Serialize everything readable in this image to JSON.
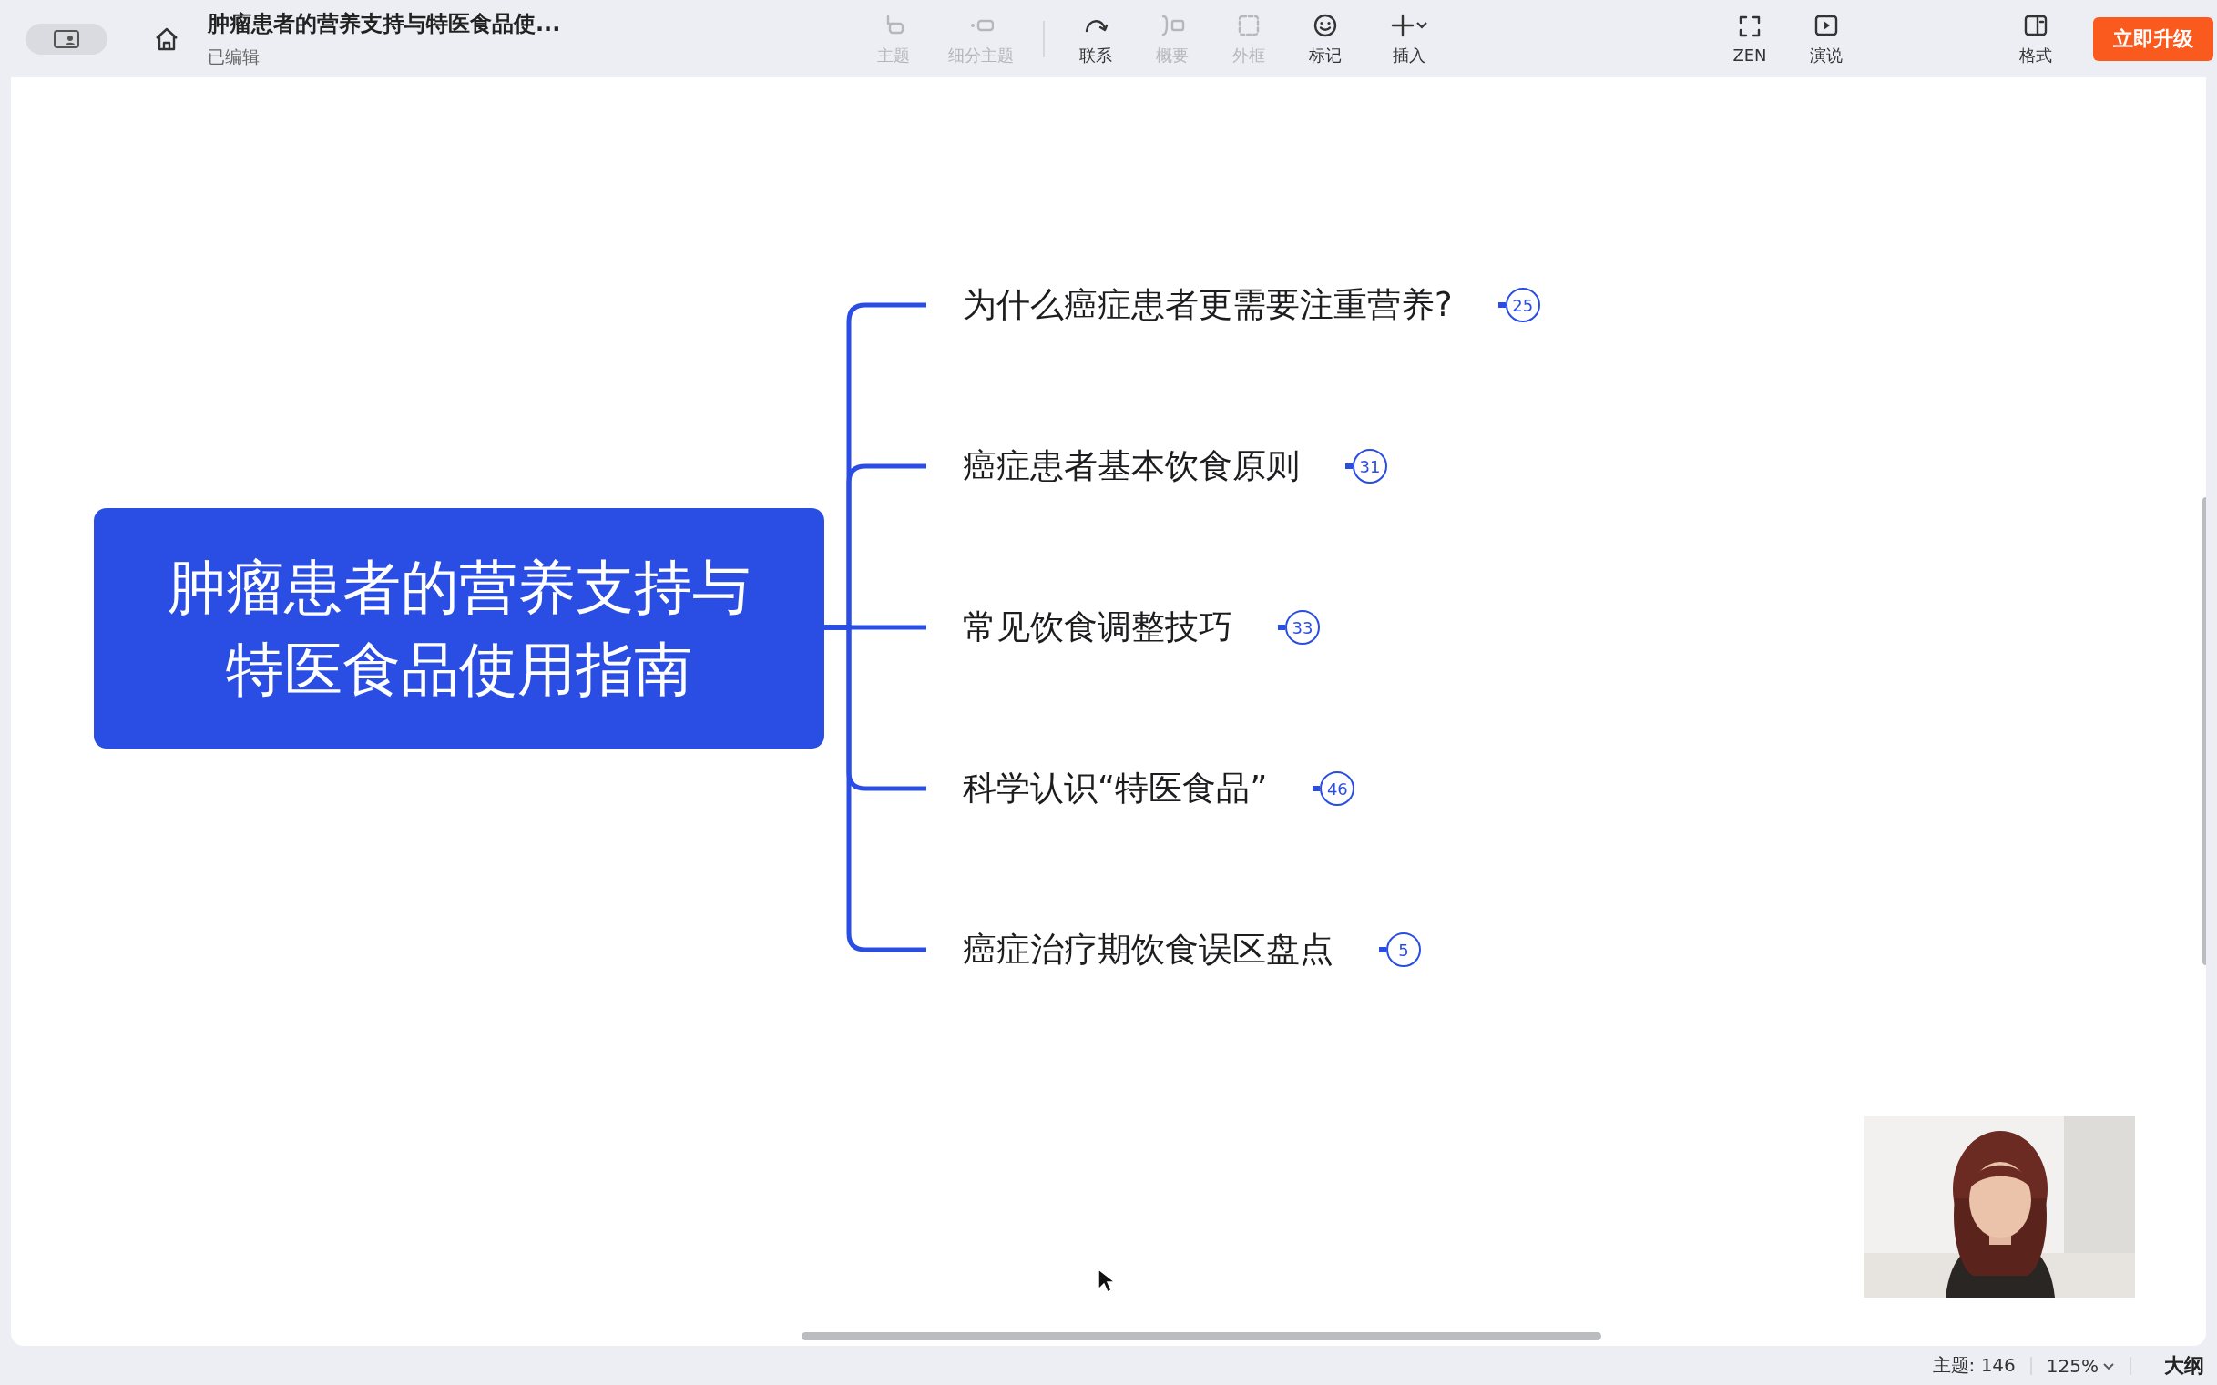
{
  "view_toggle": {
    "on": true
  },
  "document": {
    "title": "肿瘤患者的营养支持与特医食品使...",
    "status": "已编辑"
  },
  "toolbar": [
    {
      "label": "主题",
      "disabled": true
    },
    {
      "label": "细分主题",
      "disabled": true
    },
    {
      "label": "联系",
      "disabled": false
    },
    {
      "label": "概要",
      "disabled": true
    },
    {
      "label": "外框",
      "disabled": true
    },
    {
      "label": "标记",
      "disabled": false
    },
    {
      "label": "插入",
      "disabled": false
    },
    {
      "label": "ZEN",
      "disabled": false
    },
    {
      "label": "演说",
      "disabled": false
    },
    {
      "label": "格式",
      "disabled": false
    }
  ],
  "upgrade_button": "立即升级",
  "mind_map": {
    "root": "肿瘤患者的营养支持与特医食品使用指南",
    "topics": [
      {
        "text": "为什么癌症患者更需要注重营养?",
        "count": "25"
      },
      {
        "text": "癌症患者基本饮食原则",
        "count": "31"
      },
      {
        "text": "常见饮食调整技巧",
        "count": "33"
      },
      {
        "text": "科学认识“特医食品”",
        "count": "46"
      },
      {
        "text": "癌症治疗期饮食误区盘点",
        "count": "5"
      }
    ]
  },
  "status_bar": {
    "topic_count": "主题: 146",
    "zoom": "125%",
    "outline": "大纲"
  }
}
